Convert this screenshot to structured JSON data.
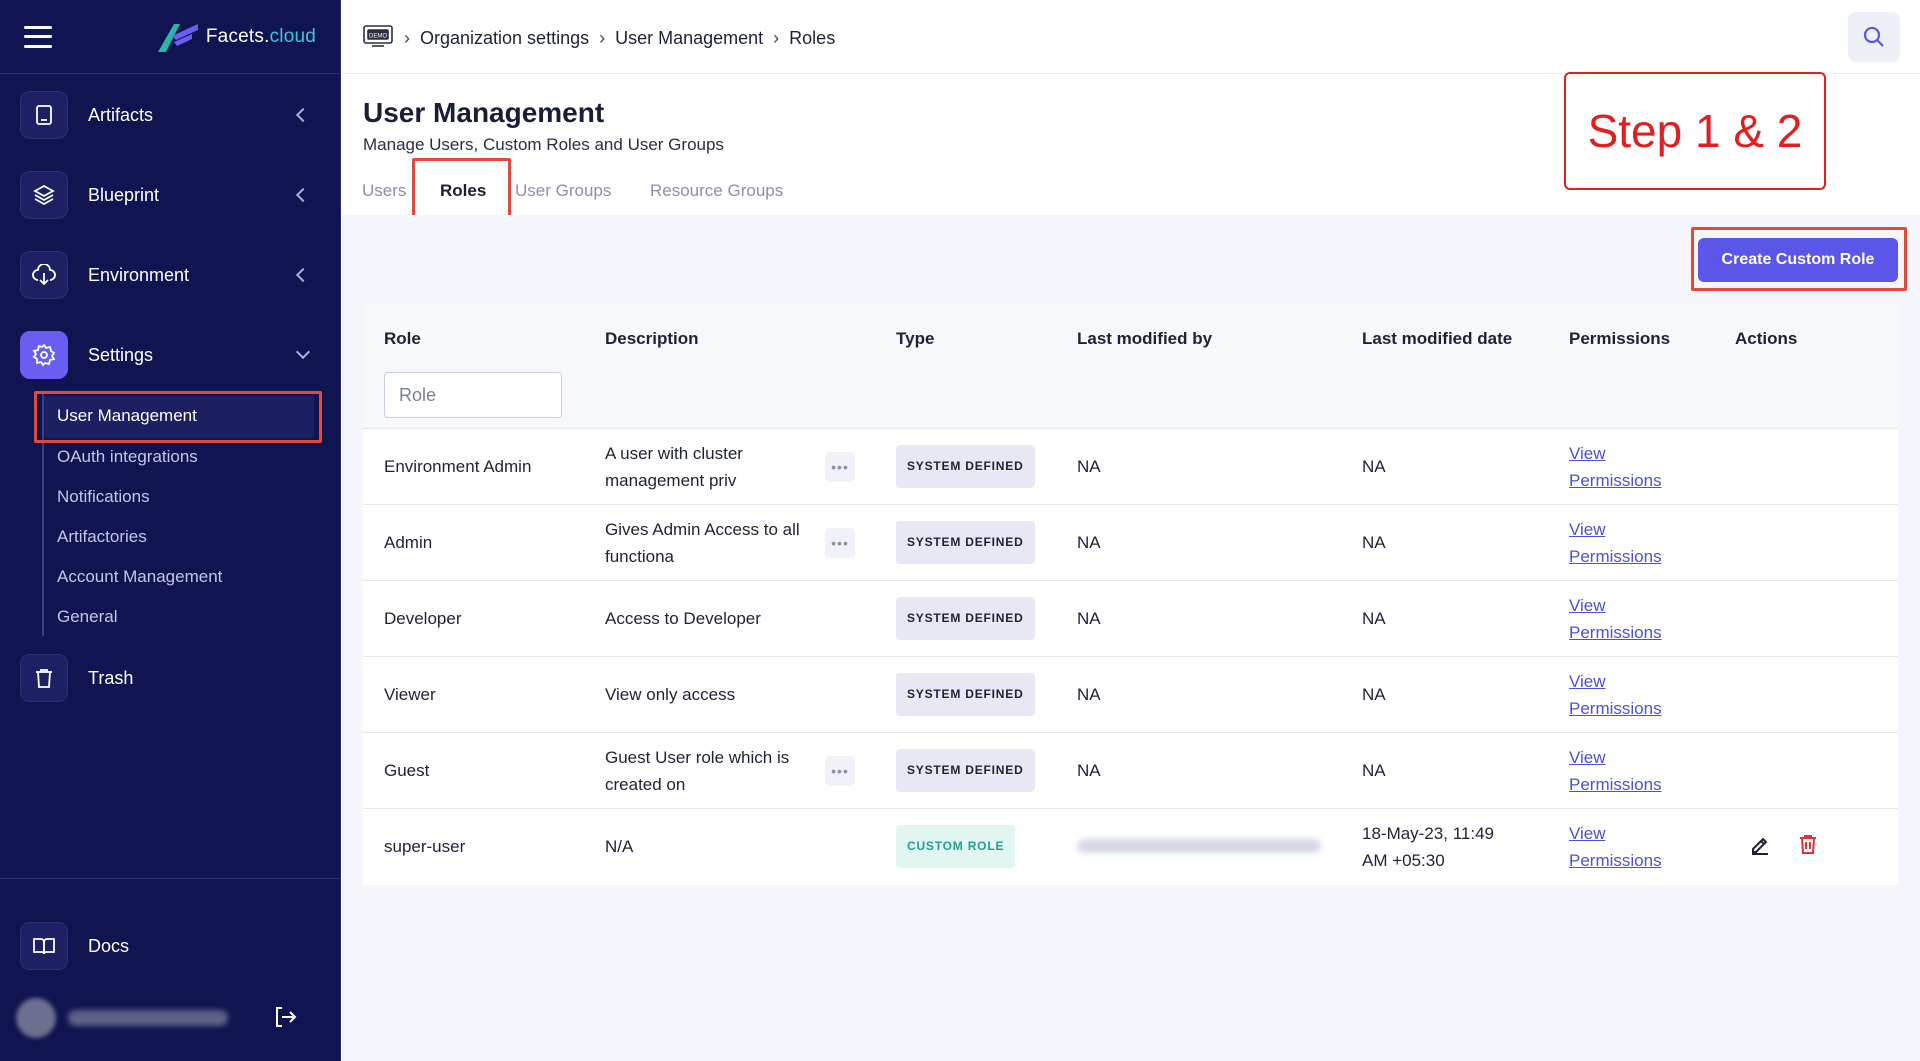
{
  "brand": {
    "name_main": "Facets.",
    "name_accent": "cloud"
  },
  "sidebar": {
    "items": [
      {
        "label": "Artifacts",
        "icon": "tablet-icon"
      },
      {
        "label": "Blueprint",
        "icon": "layers-icon"
      },
      {
        "label": "Environment",
        "icon": "cloud-download-icon"
      },
      {
        "label": "Settings",
        "icon": "gear-icon"
      },
      {
        "label": "Trash",
        "icon": "trash-icon"
      },
      {
        "label": "Docs",
        "icon": "book-icon"
      }
    ],
    "settings_sub": [
      "User Management",
      "OAuth integrations",
      "Notifications",
      "Artifactories",
      "Account Management",
      "General"
    ]
  },
  "breadcrumb": [
    "Organization settings",
    "User Management",
    "Roles"
  ],
  "page": {
    "title": "User Management",
    "subtitle": "Manage Users, Custom Roles and User Groups",
    "tabs": [
      "Users",
      "Roles",
      "User Groups",
      "Resource Groups"
    ]
  },
  "annotation": {
    "step_label": "Step 1 & 2"
  },
  "toolbar": {
    "create_label": "Create Custom Role"
  },
  "table": {
    "headers": [
      "Role",
      "Description",
      "Type",
      "Last modified by",
      "Last modified date",
      "Permissions",
      "Actions"
    ],
    "filter_placeholder": "Role",
    "perm_line1": "View",
    "perm_line2": "Permissions",
    "rows": [
      {
        "role": "Environment Admin",
        "desc1": "A user with cluster",
        "desc2": "management priv",
        "type": "SYSTEM DEFINED",
        "modified_by": "NA",
        "date1": "NA",
        "date2": ""
      },
      {
        "role": "Admin",
        "desc1": "Gives Admin Access to all",
        "desc2": "functiona",
        "type": "SYSTEM DEFINED",
        "modified_by": "NA",
        "date1": "NA",
        "date2": ""
      },
      {
        "role": "Developer",
        "desc1": "Access to Developer",
        "desc2": "",
        "type": "SYSTEM DEFINED",
        "modified_by": "NA",
        "date1": "NA",
        "date2": ""
      },
      {
        "role": "Viewer",
        "desc1": "View only access",
        "desc2": "",
        "type": "SYSTEM DEFINED",
        "modified_by": "NA",
        "date1": "NA",
        "date2": ""
      },
      {
        "role": "Guest",
        "desc1": "Guest User role which is",
        "desc2": "created on",
        "type": "SYSTEM DEFINED",
        "modified_by": "NA",
        "date1": "NA",
        "date2": ""
      },
      {
        "role": "super-user",
        "desc1": "N/A",
        "desc2": "",
        "type": "CUSTOM ROLE",
        "modified_by": "",
        "date1": "18-May-23, 11:49",
        "date2": "AM +05:30"
      }
    ]
  },
  "colors": {
    "sidebar_bg": "#101450",
    "accent": "#5b55e8",
    "highlight": "#e24a3b",
    "link": "#4b52d8"
  }
}
